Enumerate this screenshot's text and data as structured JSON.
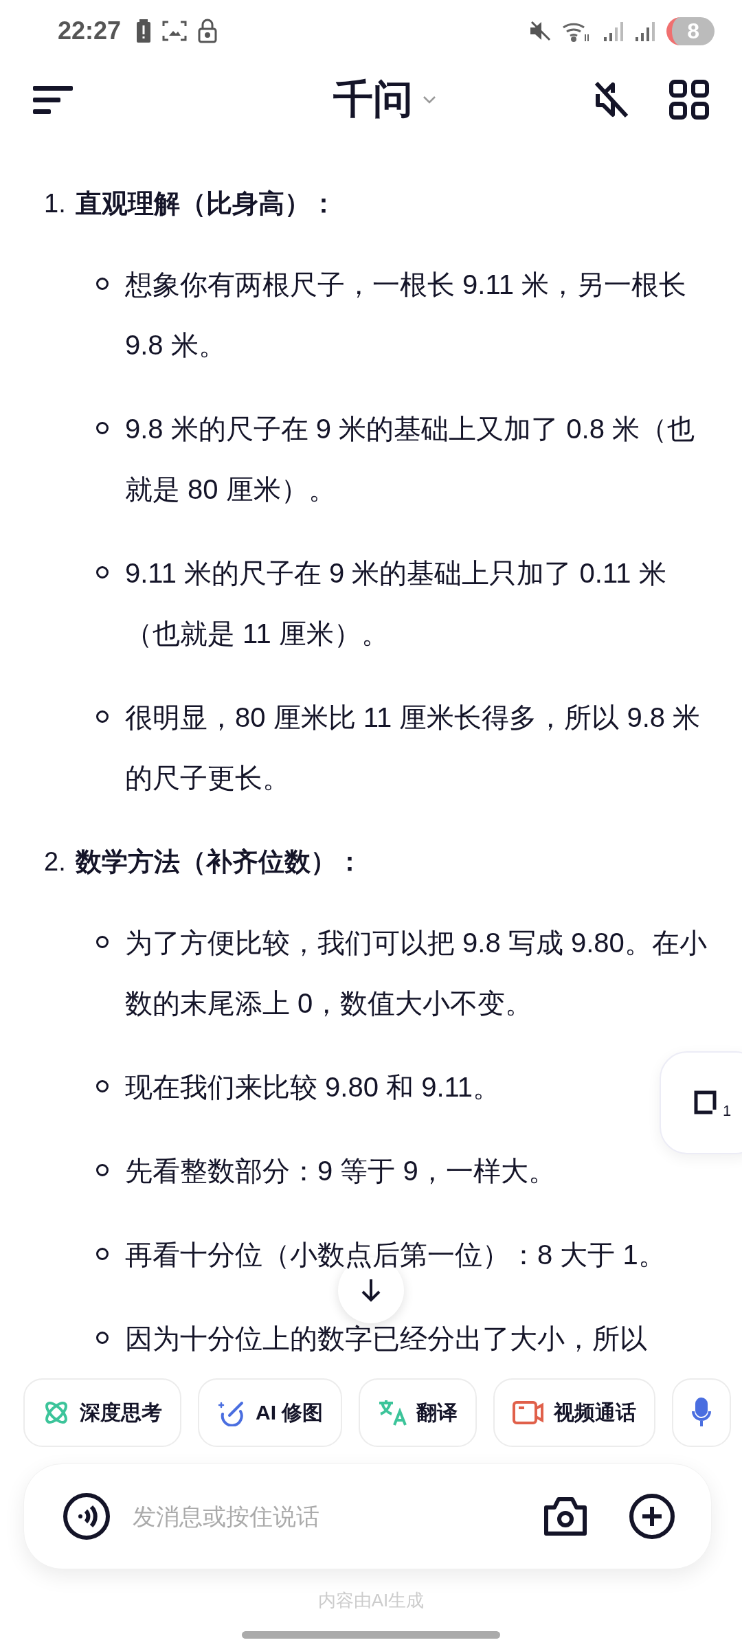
{
  "status_bar": {
    "time": "22:27",
    "battery": "8"
  },
  "header": {
    "title": "千问"
  },
  "sections": [
    {
      "number": "1.",
      "title": "直观理解（比身高）：",
      "bullets": [
        "想象你有两根尺子，一根长 9.11 米，另一根长 9.8 米。",
        "9.8 米的尺子在 9 米的基础上又加了 0.8 米（也就是 80 厘米）。",
        "9.11 米的尺子在 9 米的基础上只加了 0.11 米（也就是 11 厘米）。",
        "很明显，80 厘米比 11 厘米长得多，所以 9.8 米的尺子更长。"
      ]
    },
    {
      "number": "2.",
      "title": "数学方法（补齐位数）：",
      "bullets": [
        "为了方便比较，我们可以把 9.8 写成 9.80。在小数的末尾添上 0，数值大小不变。",
        "现在我们来比较 9.80 和 9.11。",
        "先看整数部分：9 等于 9，一样大。",
        "再看十分位（小数点后第一位）：8 大于 1。",
        "因为十分位上的数字已经分出了大小，所以"
      ]
    }
  ],
  "side_button": {
    "count": "1"
  },
  "chips": [
    {
      "kind": "think",
      "label": "深度思考"
    },
    {
      "kind": "image",
      "label": "AI 修图"
    },
    {
      "kind": "translate",
      "label": "翻译"
    },
    {
      "kind": "video",
      "label": "视频通话"
    },
    {
      "kind": "voice"
    }
  ],
  "input": {
    "placeholder": "发消息或按住说话"
  },
  "footer_note": "内容由AI生成"
}
